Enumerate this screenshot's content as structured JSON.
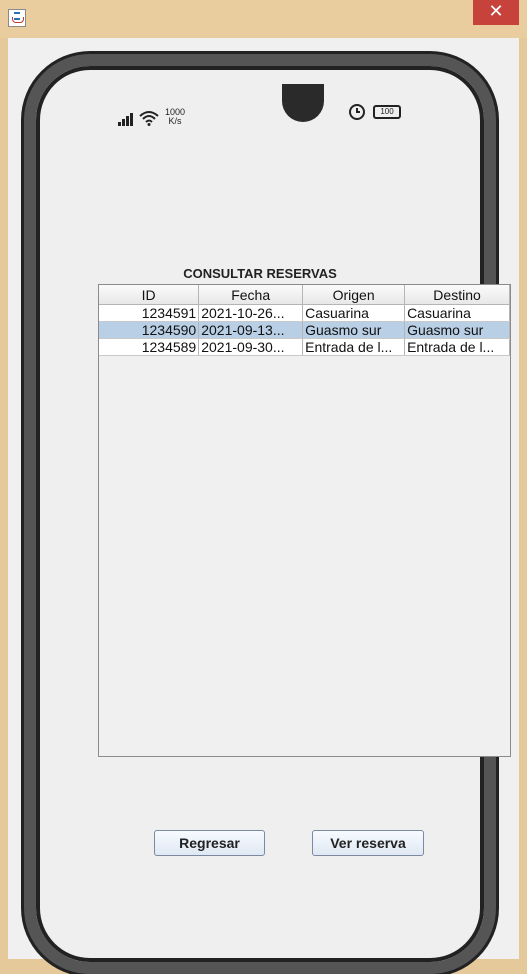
{
  "window": {
    "close_symbol": "✕",
    "icon": "java-icon"
  },
  "status_bar": {
    "speed_value": "1000",
    "speed_unit": "K/s",
    "battery": "100",
    "icons": [
      "signal-icon",
      "wifi-icon",
      "alarm-icon",
      "battery-icon"
    ]
  },
  "page": {
    "title": "CONSULTAR RESERVAS"
  },
  "table": {
    "columns": [
      "ID",
      "Fecha",
      "Origen",
      "Destino"
    ],
    "rows": [
      {
        "id": "1234591",
        "fecha": "2021-10-26...",
        "origen": "Casuarina",
        "destino": "Casuarina"
      },
      {
        "id": "1234590",
        "fecha": "2021-09-13...",
        "origen": "Guasmo sur",
        "destino": "Guasmo sur"
      },
      {
        "id": "1234589",
        "fecha": "2021-09-30...",
        "origen": "Entrada de l...",
        "destino": "Entrada de l..."
      }
    ],
    "selected_row": 1
  },
  "buttons": {
    "back": "Regresar",
    "view": "Ver reserva"
  }
}
